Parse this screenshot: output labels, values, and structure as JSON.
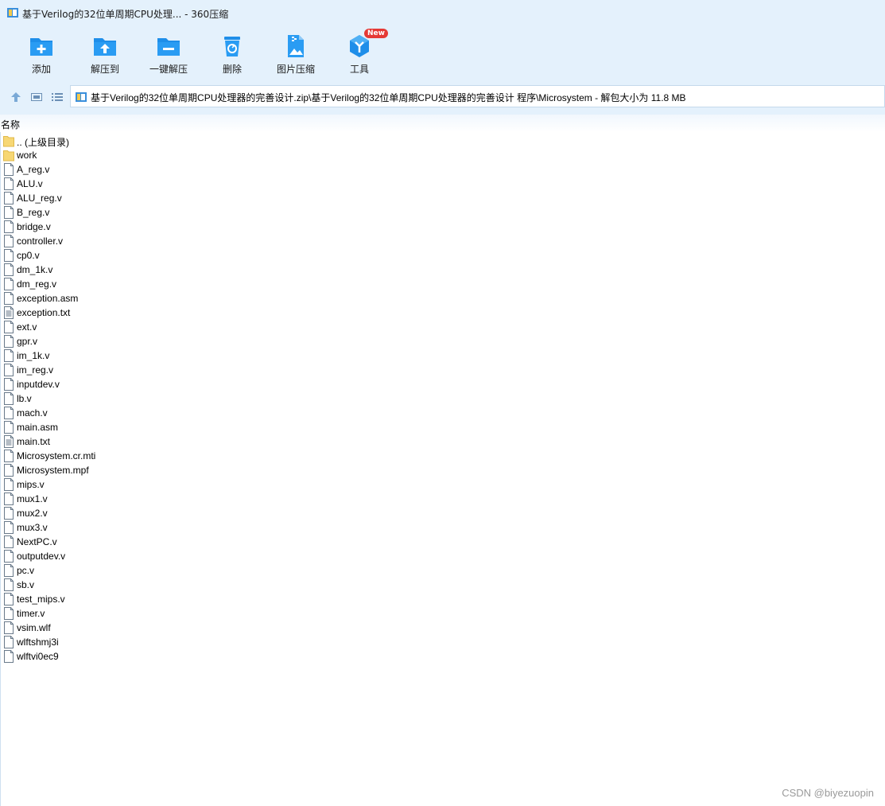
{
  "window": {
    "title": "基于Verilog的32位单周期CPU处理... - 360压缩"
  },
  "toolbar": {
    "items": [
      {
        "label": "添加",
        "icon": "add-icon"
      },
      {
        "label": "解压到",
        "icon": "extract-to-icon"
      },
      {
        "label": "一键解压",
        "icon": "one-click-extract-icon"
      },
      {
        "label": "删除",
        "icon": "delete-icon"
      },
      {
        "label": "图片压缩",
        "icon": "image-compress-icon"
      },
      {
        "label": "工具",
        "icon": "tools-icon",
        "badge": "New"
      }
    ]
  },
  "address": {
    "path": "基于Verilog的32位单周期CPU处理器的完善设计.zip\\基于Verilog的32位单周期CPU处理器的完善设计 程序\\Microsystem - 解包大小为 11.8 MB"
  },
  "list": {
    "column_name": "名称",
    "items": [
      {
        "name": ".. (上级目录)",
        "type": "folder"
      },
      {
        "name": "work",
        "type": "folder"
      },
      {
        "name": "A_reg.v",
        "type": "file"
      },
      {
        "name": "ALU.v",
        "type": "file"
      },
      {
        "name": "ALU_reg.v",
        "type": "file"
      },
      {
        "name": "B_reg.v",
        "type": "file"
      },
      {
        "name": "bridge.v",
        "type": "file"
      },
      {
        "name": "controller.v",
        "type": "file"
      },
      {
        "name": "cp0.v",
        "type": "file"
      },
      {
        "name": "dm_1k.v",
        "type": "file"
      },
      {
        "name": "dm_reg.v",
        "type": "file"
      },
      {
        "name": "exception.asm",
        "type": "file"
      },
      {
        "name": "exception.txt",
        "type": "text"
      },
      {
        "name": "ext.v",
        "type": "file"
      },
      {
        "name": "gpr.v",
        "type": "file"
      },
      {
        "name": "im_1k.v",
        "type": "file"
      },
      {
        "name": "im_reg.v",
        "type": "file"
      },
      {
        "name": "inputdev.v",
        "type": "file"
      },
      {
        "name": "lb.v",
        "type": "file"
      },
      {
        "name": "mach.v",
        "type": "file"
      },
      {
        "name": "main.asm",
        "type": "file"
      },
      {
        "name": "main.txt",
        "type": "text"
      },
      {
        "name": "Microsystem.cr.mti",
        "type": "file"
      },
      {
        "name": "Microsystem.mpf",
        "type": "file"
      },
      {
        "name": "mips.v",
        "type": "file"
      },
      {
        "name": "mux1.v",
        "type": "file"
      },
      {
        "name": "mux2.v",
        "type": "file"
      },
      {
        "name": "mux3.v",
        "type": "file"
      },
      {
        "name": "NextPC.v",
        "type": "file"
      },
      {
        "name": "outputdev.v",
        "type": "file"
      },
      {
        "name": "pc.v",
        "type": "file"
      },
      {
        "name": "sb.v",
        "type": "file"
      },
      {
        "name": "test_mips.v",
        "type": "file"
      },
      {
        "name": "timer.v",
        "type": "file"
      },
      {
        "name": "vsim.wlf",
        "type": "file"
      },
      {
        "name": "wlftshmj3i",
        "type": "file"
      },
      {
        "name": "wlftvi0ec9",
        "type": "file"
      }
    ]
  },
  "watermark": "CSDN @biyezuopin",
  "colors": {
    "chrome_bg": "#e4f1fc",
    "accent": "#1e8ee9",
    "badge": "#e53935",
    "folder": "#f7d774"
  }
}
